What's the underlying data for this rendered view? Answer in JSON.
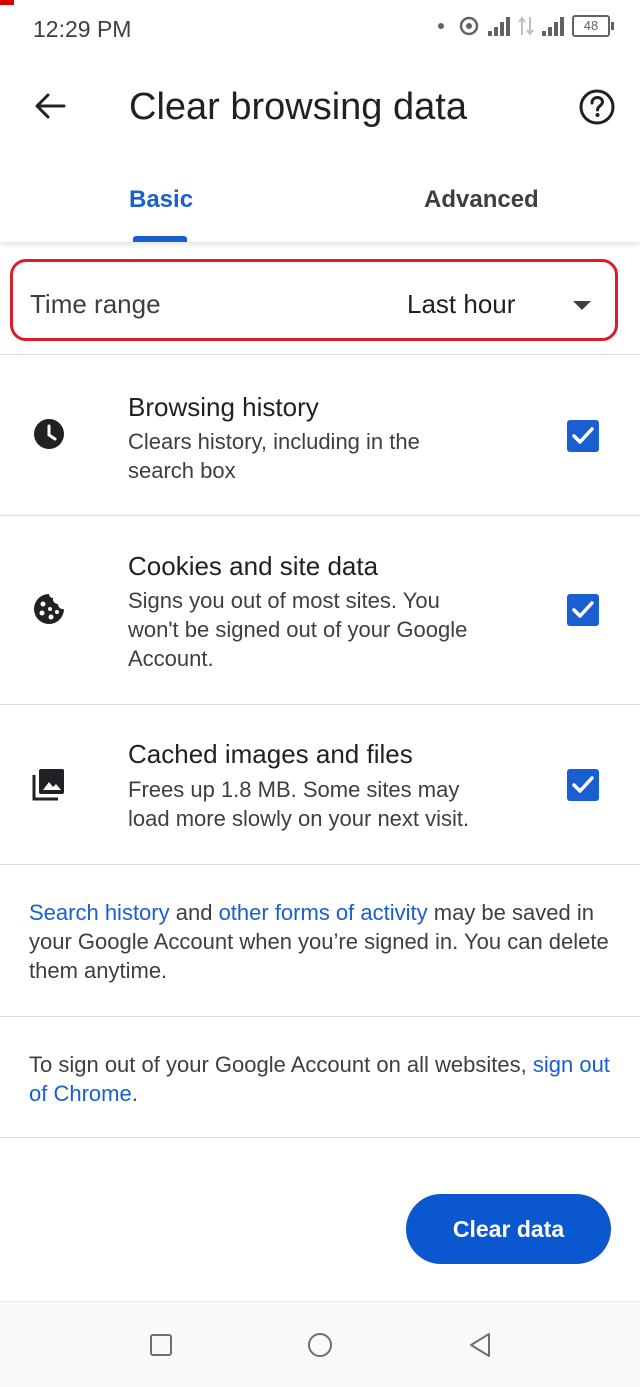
{
  "status_bar": {
    "time": "12:29 PM",
    "battery": "48"
  },
  "toolbar": {
    "back_icon": "arrow-back-icon",
    "title": "Clear browsing data",
    "help_icon": "help-circle-icon"
  },
  "tabs": [
    {
      "label": "Basic",
      "selected": true
    },
    {
      "label": "Advanced",
      "selected": false
    }
  ],
  "time_range": {
    "label": "Time range",
    "value": "Last hour"
  },
  "options": [
    {
      "icon": "clock-icon",
      "title": "Browsing history",
      "desc_lines": [
        "Clears history, including in the",
        "search box"
      ],
      "checked": true
    },
    {
      "icon": "cookie-icon",
      "title": "Cookies and site data",
      "desc_lines": [
        "Signs you out of most sites. You",
        "won't be signed out of your Google",
        "Account."
      ],
      "checked": true
    },
    {
      "icon": "images-icon",
      "title": "Cached images and files",
      "desc_lines": [
        "Frees up 1.8 MB. Some sites may",
        "load more slowly on your next visit."
      ],
      "checked": true
    }
  ],
  "info": {
    "link1": "Search history",
    "text1": " and ",
    "link2": "other forms of activity",
    "text2": " may be saved in your Google Account when you’re signed in. You can delete them anytime."
  },
  "signout": {
    "text": "To sign out of your Google Account on all websites, ",
    "link": "sign out of Chrome",
    "end": "."
  },
  "clear_button": "Clear data",
  "colors": {
    "accent": "#1a5fd1",
    "button": "#0b57d0",
    "highlight": "#d91d2c"
  }
}
